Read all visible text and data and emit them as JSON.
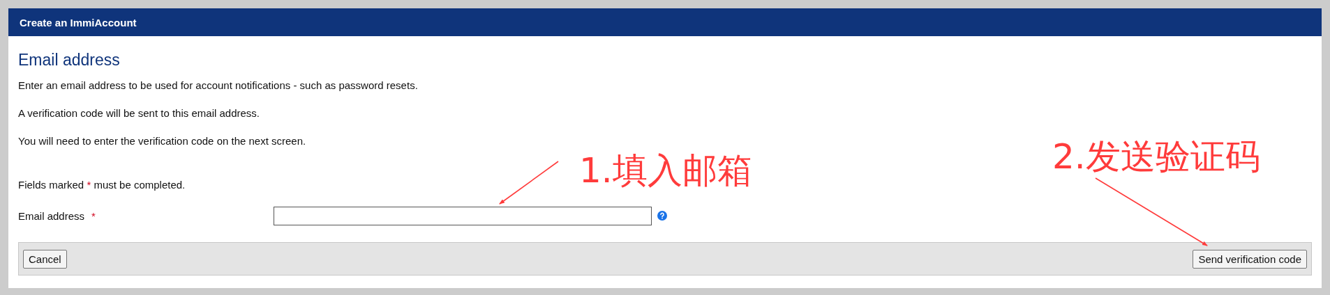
{
  "header": {
    "title": "Create an ImmiAccount"
  },
  "section": {
    "heading": "Email address",
    "paragraphs": [
      "Enter an email address to be used for account notifications - such as password resets.",
      "A verification code will be sent to this email address.",
      "You will need to enter the verification code on the next screen."
    ],
    "required_note": {
      "before": "Fields marked",
      "mark": "*",
      "after": "must be completed."
    },
    "field": {
      "label": "Email address",
      "required_mark": "*"
    }
  },
  "buttons": [
    {
      "label": "Cancel",
      "kind": "left"
    },
    {
      "label": "Send verification code",
      "kind": "right"
    }
  ],
  "annotations": [
    {
      "text": "1.填入邮箱",
      "color": "#ff3b3b"
    },
    {
      "text": "2.发送验证码",
      "color": "#ff3b3b"
    }
  ]
}
